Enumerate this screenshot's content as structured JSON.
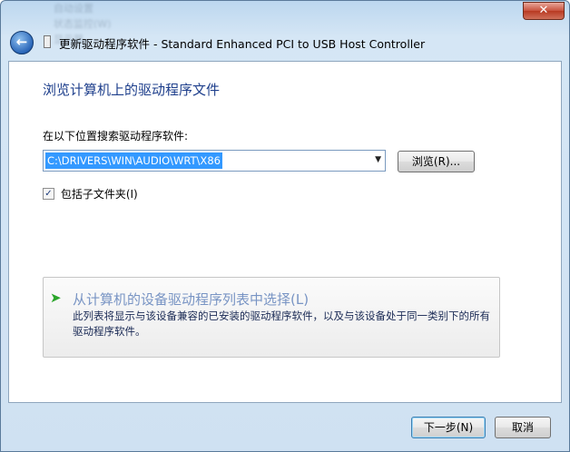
{
  "window": {
    "close_label": "✕",
    "title": "更新驱动程序软件 - Standard Enhanced PCI to USB Host Controller",
    "background_menu_blurred": [
      "自动设置",
      "状态监控(W)",
      "显示器"
    ]
  },
  "nav": {
    "back_icon": "back-arrow-icon",
    "title_icon": "device-icon"
  },
  "main": {
    "heading": "浏览计算机上的驱动程序文件",
    "search_label": "在以下位置搜索驱动程序软件:",
    "path_value": "C:\\DRIVERS\\WIN\\AUDIO\\WRT\\X86",
    "browse_label": "浏览(R)...",
    "include_subfolders_label": "包括子文件夹(I)",
    "include_subfolders_checked": true
  },
  "pick_from_list": {
    "title": "从计算机的设备驱动程序列表中选择(L)",
    "description": "此列表将显示与该设备兼容的已安装的驱动程序软件，以及与该设备处于同一类别下的所有驱动程序软件。"
  },
  "footer": {
    "next_label": "下一步(N)",
    "cancel_label": "取消"
  },
  "colors": {
    "heading": "#1e3f8c",
    "selection": "#3399ff",
    "pick_title": "#7894c4",
    "close_button": "#c8513c"
  }
}
